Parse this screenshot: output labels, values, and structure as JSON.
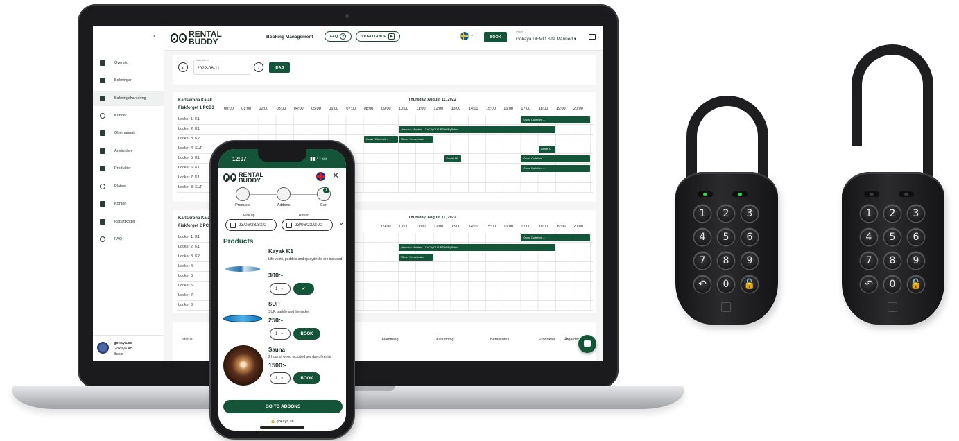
{
  "laptop": {
    "sidebar": {
      "collapse_icon": "chevron-left-icon",
      "items": [
        {
          "label": "Översikt",
          "icon": "dashboard-icon"
        },
        {
          "label": "Bokningar",
          "icon": "cart-icon"
        },
        {
          "label": "Bokningshantering",
          "icon": "booking-icon"
        },
        {
          "label": "Kunder",
          "icon": "customer-icon"
        },
        {
          "label": "Obemannat",
          "icon": "lock-icon"
        },
        {
          "label": "Användare",
          "icon": "users-icon"
        },
        {
          "label": "Produkter",
          "icon": "product-icon"
        },
        {
          "label": "Platser",
          "icon": "globe-icon"
        },
        {
          "label": "Konton",
          "icon": "account-icon"
        },
        {
          "label": "Rabattkoder",
          "icon": "discount-icon"
        },
        {
          "label": "FAQ",
          "icon": "help-icon"
        }
      ],
      "footer": {
        "site": "gokaya.se",
        "company": "Gokaya AB",
        "plan": "Basic"
      }
    },
    "header": {
      "logo_line1": "RENTAL",
      "logo_line2": "BUDDY",
      "title": "Booking Management",
      "faq_label": "FAQ",
      "faq_icon": "?",
      "video_label": "VIDEO GUIDE",
      "video_icon": "▶",
      "lang_caret": "▾",
      "book_label": "BOOK",
      "plats_label": "Plats",
      "plats_value": "Gokaya DEMO Site Manned ▾"
    },
    "date_bar": {
      "prev": "‹",
      "next": "›",
      "label": "Välj datum",
      "value": "2022-08-11",
      "today_label": "IDAG"
    },
    "schedule1": {
      "site_line1": "Karlskrona Kajak",
      "site_line2": "Fiskforget 1 PCB3",
      "day": "Thursday, August 11, 2022",
      "hours": [
        "00:00",
        "01:00",
        "02:00",
        "03:00",
        "04:00",
        "05:00",
        "06:00",
        "07:00",
        "08:00",
        "09:00",
        "10:00",
        "11:00",
        "12:00",
        "13:00",
        "14:00",
        "15:00",
        "16:00",
        "17:00",
        "18:00",
        "19:00",
        "20:00"
      ],
      "rows": [
        "Locker 1: K1",
        "Locker 2: K1",
        "Locker 3: K2",
        "Locker 4: SUP",
        "Locker 5: K1",
        "Locker 6: K1",
        "Locker 7: K1",
        "Locker 8: SUP"
      ],
      "bookings": [
        {
          "row": 0,
          "start": 17,
          "end": 21,
          "label": "Oscar Cullefors --"
        },
        {
          "row": 1,
          "start": 10,
          "end": 19,
          "label": "Veronica Monfen -- XaC5gCUAIRGH5Rg5Nen"
        },
        {
          "row": 2,
          "start": 8,
          "end": 10,
          "label": "Jonas Hillerbrott --"
        },
        {
          "row": 2,
          "start": 10,
          "end": 12,
          "label": "Olivier Herve bozin"
        },
        {
          "row": 3,
          "start": 18,
          "end": 19,
          "label": "Daniel O"
        },
        {
          "row": 4,
          "start": 12.6,
          "end": 13.6,
          "label": "Daniel Fli"
        },
        {
          "row": 4,
          "start": 17,
          "end": 21,
          "label": "Oscar Cullefors --"
        },
        {
          "row": 5,
          "start": 17,
          "end": 21,
          "label": "Oscar Cullefors --"
        }
      ]
    },
    "schedule2": {
      "site_line1": "Karlskrona Kajak",
      "site_line2": "Fiskforget 2 PCB3",
      "day": "Thursday, August 11, 2022",
      "rows": [
        "Locker 1: K1",
        "Locker 2: K1",
        "Locker 3: K2",
        "Locker 4:",
        "Locker 5:",
        "Locker 6:",
        "Locker 7:",
        "Locker 8:"
      ],
      "bookings": [
        {
          "row": 0,
          "start": 17,
          "end": 21,
          "label": "Oscar Cullefors --"
        },
        {
          "row": 1,
          "start": 10,
          "end": 19,
          "label": "Veronica Monfen -- XaC5gCUAIRGH5Rg5Nen"
        },
        {
          "row": 2,
          "start": 10,
          "end": 12,
          "label": "Olivier Herve bozin"
        }
      ]
    },
    "orders": {
      "columns": [
        "Status",
        "Hämtning",
        "Avlämning",
        "Betalstatus",
        "Produkter",
        "Åtgärder"
      ]
    }
  },
  "phone": {
    "time": "12:07",
    "status_icons": "▮▮ ◠ ▭",
    "logo_line1": "RENTAL",
    "logo_line2": "BUDDY",
    "close": "✕",
    "steps": [
      "Products",
      "Addons",
      "Cart"
    ],
    "cart_count": "1",
    "pickup_label": "Pick up",
    "pickup_value": "23/06/23/8:00",
    "return_label": "Return",
    "return_value": "23/06/23/9:00",
    "expand": "⌄",
    "products_heading": "Products",
    "products": [
      {
        "name": "Kayak K1",
        "desc": "Life vests, paddles and spraydecks are included.",
        "price": "300:-",
        "qty": "1",
        "action": "✓"
      },
      {
        "name": "SUP",
        "desc": "SUP, paddle and life jacket",
        "price": "250:-",
        "qty": "1",
        "action": "BOOK"
      },
      {
        "name": "Sauna",
        "desc": "2 hour of wood included per day of rental",
        "price": "1500:-",
        "qty": "1",
        "action": "BOOK"
      }
    ],
    "go_to_addons": "GO TO ADDONS",
    "url": "🔒 gokaya.se"
  },
  "padlocks": {
    "keys": [
      "1",
      "2",
      "3",
      "4",
      "5",
      "6",
      "7",
      "8",
      "9",
      "↶",
      "0",
      "🔓"
    ],
    "led_color": "#2fd14a"
  }
}
